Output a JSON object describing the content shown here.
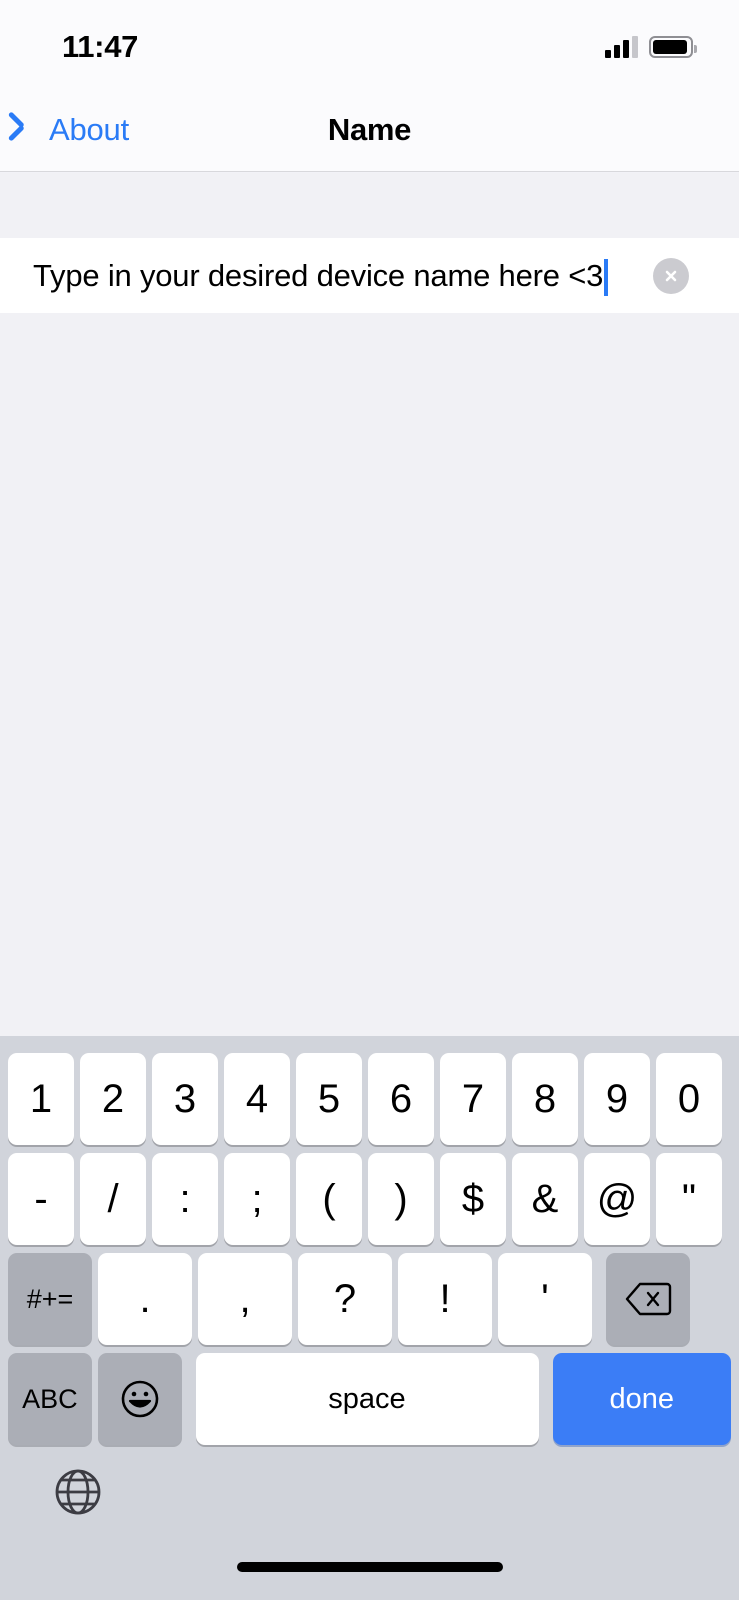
{
  "status_bar": {
    "time": "11:47",
    "signal_icon": "cellular-signal-icon",
    "signal_bars_filled": 3,
    "signal_bars_total": 4,
    "battery_icon": "battery-icon",
    "battery_level_percent": 94
  },
  "nav_bar": {
    "back_label": "About",
    "back_icon": "chevron-left-icon",
    "title": "Name"
  },
  "text_field": {
    "value": "Type in your desired device name here <3",
    "placeholder": "Name",
    "clear_icon": "clear-circle-icon",
    "caret_color": "#2a7bf6",
    "focused": true
  },
  "keyboard": {
    "type": "numeric-symbols",
    "rows": [
      {
        "name": "number-row",
        "keys": [
          {
            "label": "1",
            "style": "light"
          },
          {
            "label": "2",
            "style": "light"
          },
          {
            "label": "3",
            "style": "light"
          },
          {
            "label": "4",
            "style": "light"
          },
          {
            "label": "5",
            "style": "light"
          },
          {
            "label": "6",
            "style": "light"
          },
          {
            "label": "7",
            "style": "light"
          },
          {
            "label": "8",
            "style": "light"
          },
          {
            "label": "9",
            "style": "light"
          },
          {
            "label": "0",
            "style": "light"
          }
        ]
      },
      {
        "name": "symbol-row",
        "keys": [
          {
            "label": "-",
            "style": "light"
          },
          {
            "label": "/",
            "style": "light"
          },
          {
            "label": ":",
            "style": "light"
          },
          {
            "label": ";",
            "style": "light"
          },
          {
            "label": "(",
            "style": "light"
          },
          {
            "label": ")",
            "style": "light"
          },
          {
            "label": "$",
            "style": "light"
          },
          {
            "label": "&",
            "style": "light"
          },
          {
            "label": "@",
            "style": "light"
          },
          {
            "label": "\"",
            "style": "light"
          }
        ]
      },
      {
        "name": "punctuation-row",
        "keys": [
          {
            "label": "#+=",
            "style": "dark"
          },
          {
            "label": ".",
            "style": "light"
          },
          {
            "label": ",",
            "style": "light"
          },
          {
            "label": "?",
            "style": "light"
          },
          {
            "label": "!",
            "style": "light"
          },
          {
            "label": "'",
            "style": "light"
          },
          {
            "label": "",
            "style": "dark",
            "icon": "backspace-icon"
          }
        ]
      },
      {
        "name": "bottom-row",
        "keys": [
          {
            "label": "ABC",
            "style": "dark"
          },
          {
            "label": "",
            "style": "dark",
            "icon": "emoji-icon"
          },
          {
            "label": "space",
            "style": "light"
          },
          {
            "label": "done",
            "style": "blue"
          }
        ]
      }
    ],
    "globe_icon": "globe-icon"
  },
  "home_indicator": "home-indicator",
  "colors": {
    "accent_blue": "#2a7bf6",
    "done_key_blue": "#3b7df6",
    "keyboard_background": "#d1d4db",
    "dark_key": "#abaeb6",
    "content_background": "#f1f1f5"
  }
}
